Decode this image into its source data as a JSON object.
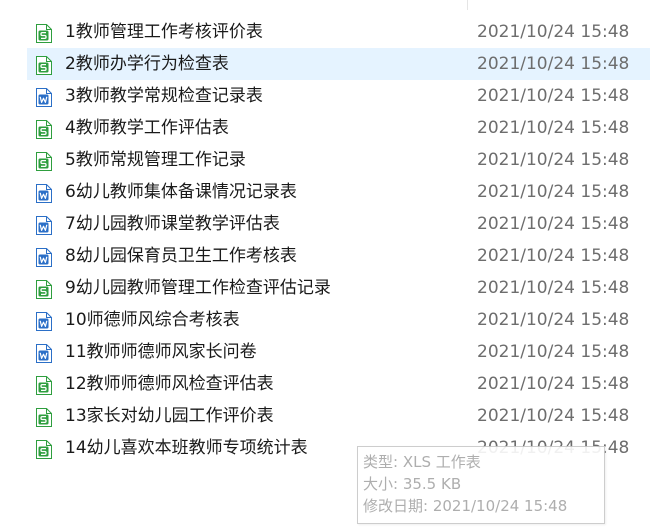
{
  "colors": {
    "selected_row_bg": "#e5f3ff",
    "xls_icon_green": "#2e9e3e",
    "doc_icon_blue": "#2b6fc7",
    "name_text": "#1a1a1a",
    "date_text": "#6d6d6d",
    "tooltip_text": "#a6a6a6"
  },
  "files": [
    {
      "name": "1教师管理工作考核评价表",
      "date": "2021/10/24 15:48",
      "icon": "xls-file-icon",
      "selected": false
    },
    {
      "name": "2教师办学行为检查表",
      "date": "2021/10/24 15:48",
      "icon": "xls-file-icon",
      "selected": true
    },
    {
      "name": "3教师教学常规检查记录表",
      "date": "2021/10/24 15:48",
      "icon": "doc-file-icon",
      "selected": false
    },
    {
      "name": "4教师教学工作评估表",
      "date": "2021/10/24 15:48",
      "icon": "xls-file-icon",
      "selected": false
    },
    {
      "name": "5教师常规管理工作记录",
      "date": "2021/10/24 15:48",
      "icon": "xls-file-icon",
      "selected": false
    },
    {
      "name": "6幼儿教师集体备课情况记录表",
      "date": "2021/10/24 15:48",
      "icon": "doc-file-icon",
      "selected": false
    },
    {
      "name": "7幼儿园教师课堂教学评估表",
      "date": "2021/10/24 15:48",
      "icon": "doc-file-icon",
      "selected": false
    },
    {
      "name": "8幼儿园保育员卫生工作考核表",
      "date": "2021/10/24 15:48",
      "icon": "doc-file-icon",
      "selected": false
    },
    {
      "name": "9幼儿园教师管理工作检查评估记录",
      "date": "2021/10/24 15:48",
      "icon": "xls-file-icon",
      "selected": false
    },
    {
      "name": "10师德师风综合考核表",
      "date": "2021/10/24 15:48",
      "icon": "doc-file-icon",
      "selected": false
    },
    {
      "name": "11教师师德师风家长问卷",
      "date": "2021/10/24 15:48",
      "icon": "doc-file-icon",
      "selected": false
    },
    {
      "name": "12教师师德师风检查评估表",
      "date": "2021/10/24 15:48",
      "icon": "xls-file-icon",
      "selected": false
    },
    {
      "name": "13家长对幼儿园工作评价表",
      "date": "2021/10/24 15:48",
      "icon": "xls-file-icon",
      "selected": false
    },
    {
      "name": "14幼儿喜欢本班教师专项统计表",
      "date": "2021/10/24 15:48",
      "icon": "xls-file-icon",
      "selected": false
    }
  ],
  "tooltip": {
    "type_line": "类型: XLS 工作表",
    "size_line": "大小: 35.5 KB",
    "modified_line": "修改日期: 2021/10/24 15:48"
  }
}
